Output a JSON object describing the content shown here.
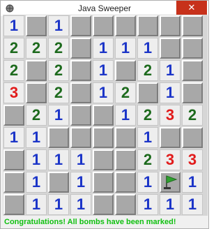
{
  "window": {
    "title": "Java Sweeper",
    "close_label": "✕"
  },
  "colors": {
    "one": "#1c35c8",
    "two": "#1d6a1d",
    "three": "#e11b1b",
    "status": "#10c010"
  },
  "board": {
    "rows": 9,
    "cols": 9,
    "cells": [
      [
        "1",
        "C",
        "1",
        "C",
        "C",
        "C",
        "C",
        "C",
        "C"
      ],
      [
        "2",
        "2",
        "2",
        "C",
        "1",
        "1",
        "1",
        "C",
        "C"
      ],
      [
        "2",
        "C",
        "2",
        "C",
        "1",
        "C",
        "2",
        "1",
        "C"
      ],
      [
        "3",
        "C",
        "2",
        "C",
        "1",
        "2",
        "C",
        "1",
        "C"
      ],
      [
        "C",
        "2",
        "1",
        "C",
        "C",
        "1",
        "2",
        "3",
        "2"
      ],
      [
        "1",
        "1",
        "C",
        "C",
        "C",
        "C",
        "1",
        "C",
        "C"
      ],
      [
        "C",
        "1",
        "1",
        "1",
        "C",
        "C",
        "2",
        "3",
        "3"
      ],
      [
        "C",
        "1",
        "C",
        "1",
        "C",
        "C",
        "1",
        "F",
        "1"
      ],
      [
        "C",
        "1",
        "1",
        "1",
        "C",
        "C",
        "1",
        "1",
        "1"
      ]
    ]
  },
  "status": {
    "message": "Congratulations! All bombs have been marked!"
  }
}
